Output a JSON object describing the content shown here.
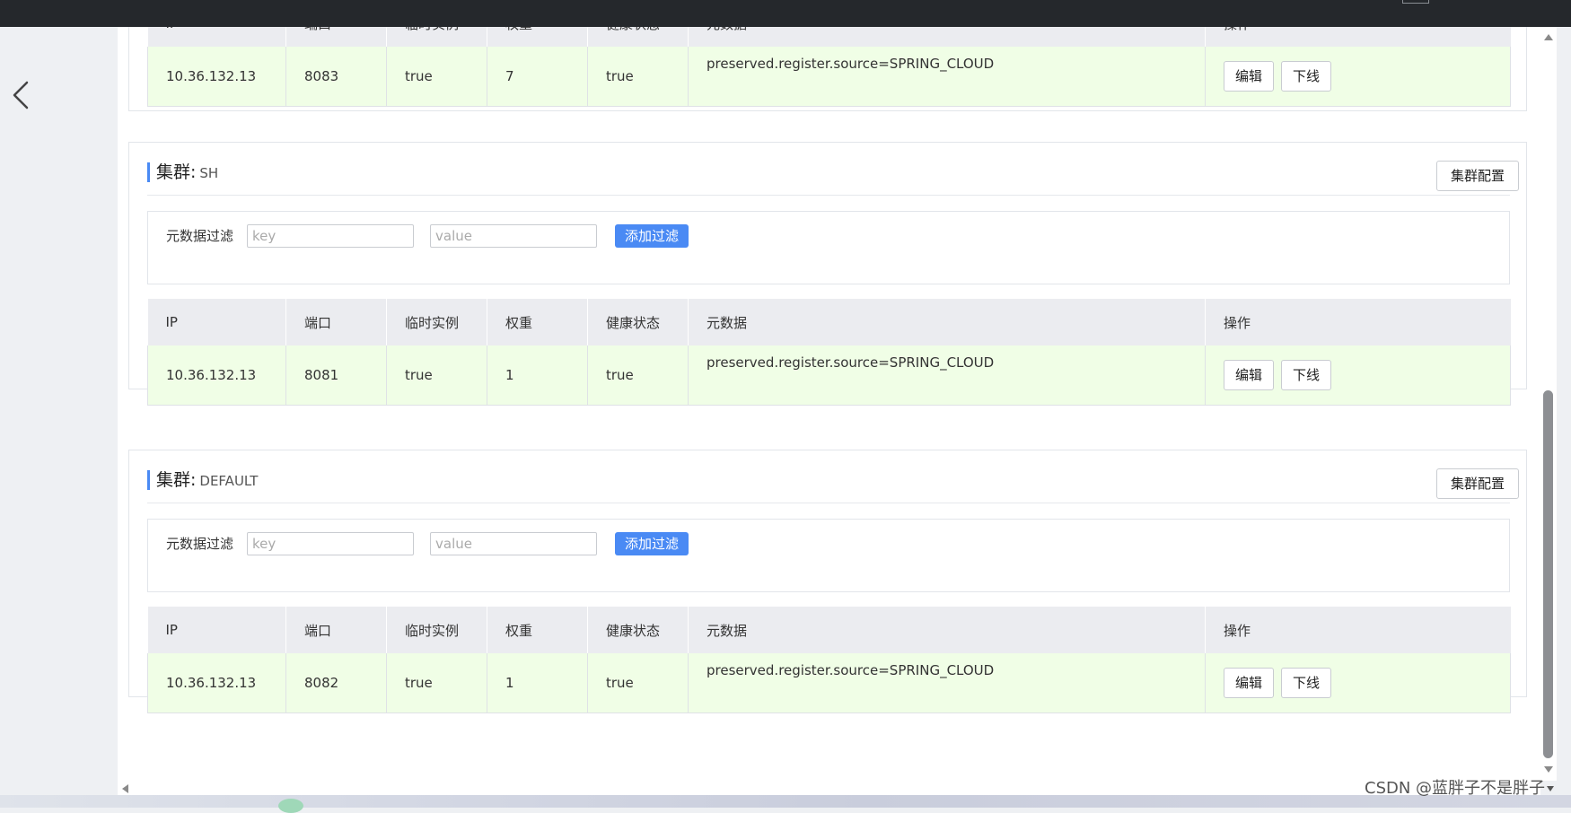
{
  "colors": {
    "accent": "#4a8af4",
    "row_bg": "#f0fee6",
    "header_bg": "#ebecf0",
    "topbar": "#25282c"
  },
  "nav": {
    "back_icon": "chevron-left-icon"
  },
  "labels": {
    "cluster_prefix": "集群:",
    "cluster_config": "集群配置",
    "filter_label": "元数据过滤",
    "add_filter": "添加过滤",
    "key_placeholder": "key",
    "value_placeholder": "value",
    "edit": "编辑",
    "offline": "下线"
  },
  "columns": [
    "IP",
    "端口",
    "临时实例",
    "权重",
    "健康状态",
    "元数据",
    "操作"
  ],
  "clusters": [
    {
      "name": "",
      "rows": [
        {
          "ip": "10.36.132.13",
          "port": "8083",
          "ephemeral": "true",
          "weight": "7",
          "healthy": "true",
          "metadata": "preserved.register.source=SPRING_CLOUD"
        }
      ]
    },
    {
      "name": "SH",
      "rows": [
        {
          "ip": "10.36.132.13",
          "port": "8081",
          "ephemeral": "true",
          "weight": "1",
          "healthy": "true",
          "metadata": "preserved.register.source=SPRING_CLOUD"
        }
      ]
    },
    {
      "name": "DEFAULT",
      "rows": [
        {
          "ip": "10.36.132.13",
          "port": "8082",
          "ephemeral": "true",
          "weight": "1",
          "healthy": "true",
          "metadata": "preserved.register.source=SPRING_CLOUD"
        }
      ]
    }
  ],
  "watermark": "CSDN @蓝胖子不是胖子"
}
